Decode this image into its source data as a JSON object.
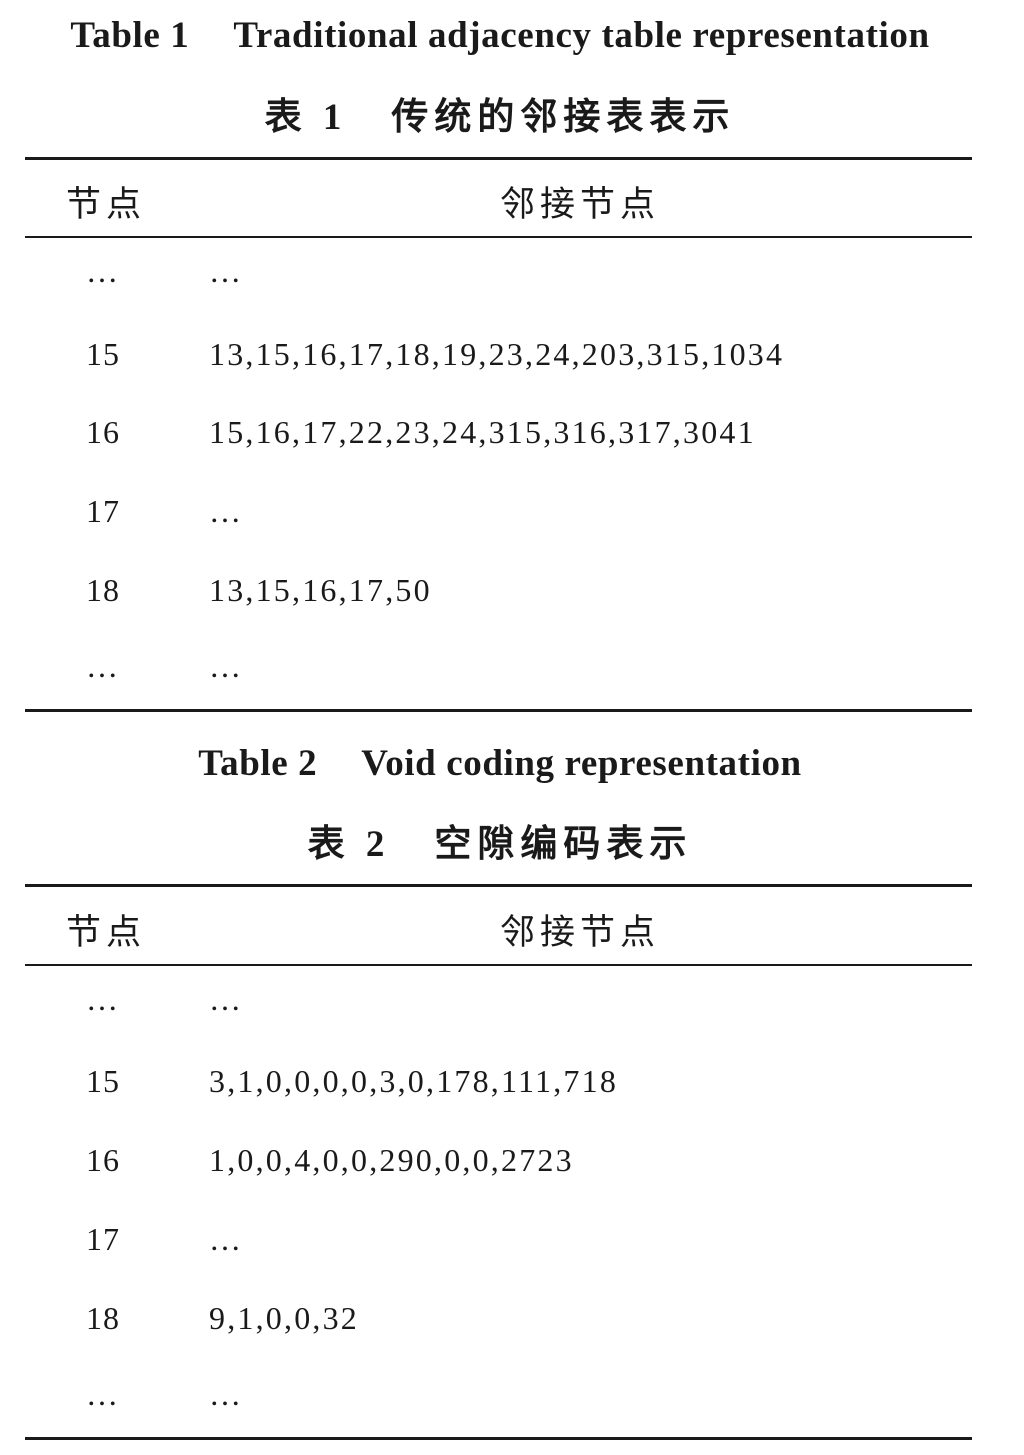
{
  "tables": [
    {
      "title_en_num": "Table 1",
      "title_en": "Traditional adjacency table representation",
      "title_zh_num": "表 1",
      "title_zh": "传统的邻接表表示",
      "header_node": "节点",
      "header_adj": "邻接节点",
      "rows": [
        {
          "node": "…",
          "adj": "…"
        },
        {
          "node": "15",
          "adj": "13,15,16,17,18,19,23,24,203,315,1034"
        },
        {
          "node": "16",
          "adj": "15,16,17,22,23,24,315,316,317,3041"
        },
        {
          "node": "17",
          "adj": "…"
        },
        {
          "node": "18",
          "adj": "13,15,16,17,50"
        },
        {
          "node": "…",
          "adj": "…"
        }
      ]
    },
    {
      "title_en_num": "Table 2",
      "title_en": "Void coding representation",
      "title_zh_num": "表 2",
      "title_zh": "空隙编码表示",
      "header_node": "节点",
      "header_adj": "邻接节点",
      "rows": [
        {
          "node": "…",
          "adj": "…"
        },
        {
          "node": "15",
          "adj": "3,1,0,0,0,0,3,0,178,111,718"
        },
        {
          "node": "16",
          "adj": "1,0,0,4,0,0,290,0,0,2723"
        },
        {
          "node": "17",
          "adj": "…"
        },
        {
          "node": "18",
          "adj": "9,1,0,0,32"
        },
        {
          "node": "…",
          "adj": "…"
        }
      ]
    }
  ]
}
